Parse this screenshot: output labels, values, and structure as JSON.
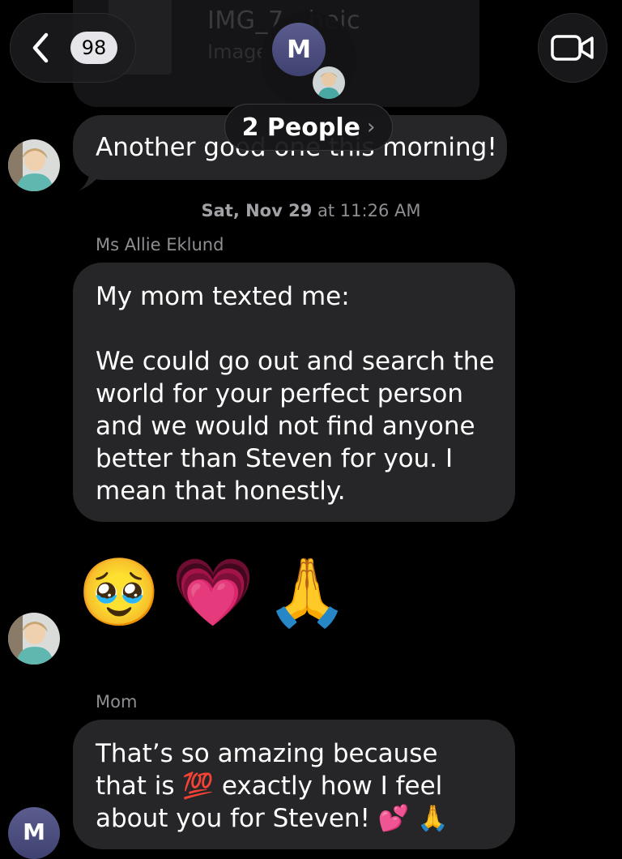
{
  "header": {
    "back_count": "98",
    "group_initial": "M",
    "people_label": "2 People",
    "people_chevron": "›"
  },
  "attachment_preview": {
    "filename": "IMG_7...heic",
    "type_label": "Image"
  },
  "messages": {
    "first": {
      "text": "Another good one this morning!"
    },
    "timestamp": {
      "day": "Sat, Nov 29",
      "time": "at 11:26 AM"
    },
    "second": {
      "sender": "Ms Allie Eklund",
      "text": "My mom texted me:\n\nWe could go out and search the world for your perfect person and we would not find anyone better than Steven for you. I mean that honestly."
    },
    "emoji_reply": {
      "emojis": [
        "🥹",
        "💗",
        "🙏"
      ]
    },
    "third": {
      "sender": "Mom",
      "text": "That’s so amazing because that is 💯 exactly how I feel about you for Steven! 💕 🙏"
    }
  },
  "colors": {
    "background": "#000000",
    "bubble": "#262628",
    "secondary_text": "#8e8e93"
  },
  "icons": {
    "back": "chevron-left-icon",
    "video": "video-camera-icon"
  }
}
